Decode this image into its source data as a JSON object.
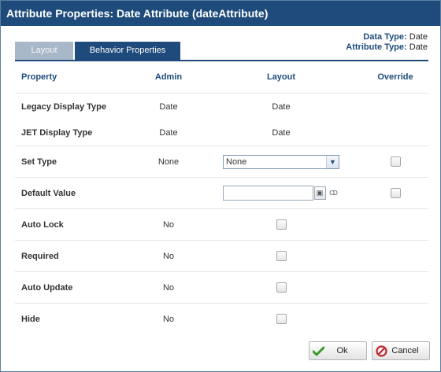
{
  "dialog": {
    "title": "Attribute Properties: Date Attribute (dateAttribute)",
    "data_type_label": "Data Type:",
    "data_type_value": "Date",
    "attribute_type_label": "Attribute Type:",
    "attribute_type_value": "Date"
  },
  "tabs": [
    {
      "label": "Layout",
      "active": false
    },
    {
      "label": "Behavior Properties",
      "active": true
    }
  ],
  "columns": {
    "property": "Property",
    "admin": "Admin",
    "layout": "Layout",
    "override": "Override"
  },
  "rows": {
    "legacy_display_type": {
      "label": "Legacy Display Type",
      "admin": "Date",
      "layout": "Date"
    },
    "jet_display_type": {
      "label": "JET Display Type",
      "admin": "Date",
      "layout": "Date"
    },
    "set_type": {
      "label": "Set Type",
      "admin": "None",
      "layout_selected": "None",
      "override_checked": false
    },
    "default_value": {
      "label": "Default Value",
      "admin": "",
      "layout_value": "",
      "override_checked": false
    },
    "auto_lock": {
      "label": "Auto Lock",
      "admin": "No",
      "layout_checked": false
    },
    "required": {
      "label": "Required",
      "admin": "No",
      "layout_checked": false
    },
    "auto_update": {
      "label": "Auto Update",
      "admin": "No",
      "layout_checked": false
    },
    "hide": {
      "label": "Hide",
      "admin": "No",
      "layout_checked": false
    }
  },
  "buttons": {
    "ok_label": "Ok",
    "cancel_label": "Cancel"
  },
  "icons": {
    "select_arrow": "chevron-down-icon",
    "calendar": "calendar-icon",
    "clear": "clear-date-icon",
    "ok": "check-icon",
    "cancel": "cancel-circle-icon"
  },
  "colors": {
    "title_bar": "#1e4b7b",
    "header_text": "#1e4b7b",
    "inactive_tab": "#a9b8c9",
    "ok_green": "#3a9a2a",
    "cancel_red": "#c0282f"
  }
}
